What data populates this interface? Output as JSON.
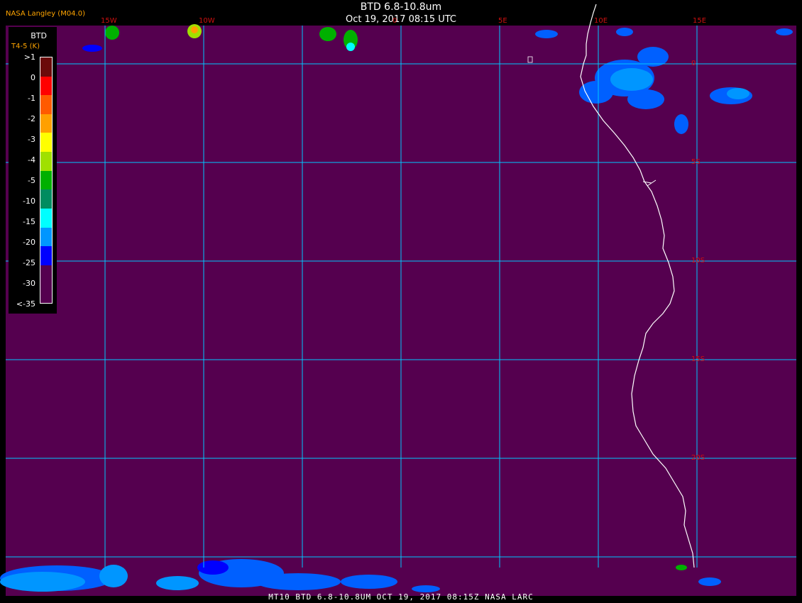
{
  "title": "BTD 6.8-10.8um",
  "datetime": "Oct 19, 2017 08:15 UTC",
  "credit": "NASA Langley (M04.0)",
  "footer": "MT10  BTD 6.8-10.8UM  OCT 19, 2017 08:15Z  NASA LARC",
  "legend": {
    "title": "BTD",
    "subtitle": "T4-5 (K)",
    "entries": [
      {
        "label": ">1",
        "color": "#6b0a0a"
      },
      {
        "label": "0",
        "color": "#ff0000"
      },
      {
        "label": "-1",
        "color": "#ff5a00"
      },
      {
        "label": "-2",
        "color": "#ffa000"
      },
      {
        "label": "-3",
        "color": "#ffff00"
      },
      {
        "label": "-4",
        "color": "#a0e000"
      },
      {
        "label": "-5",
        "color": "#00b000"
      },
      {
        "label": "-10",
        "color": "#008c60"
      },
      {
        "label": "-15",
        "color": "#00ffff"
      },
      {
        "label": "-20",
        "color": "#0096ff"
      },
      {
        "label": "-25",
        "color": "#0000ff"
      },
      {
        "label": "-30",
        "color": "#55004f"
      },
      {
        "label": "<-35",
        "color": "#55004f"
      }
    ]
  },
  "grid": {
    "lon_labels": [
      "15W",
      "10W",
      "0",
      "5E",
      "10E",
      "15E"
    ],
    "lat_labels": [
      "0",
      "5S",
      "10S",
      "15S",
      "20S"
    ],
    "line_color": "#00c8ff"
  },
  "background_color": "#55004f",
  "coastline_color": "#ffffff"
}
